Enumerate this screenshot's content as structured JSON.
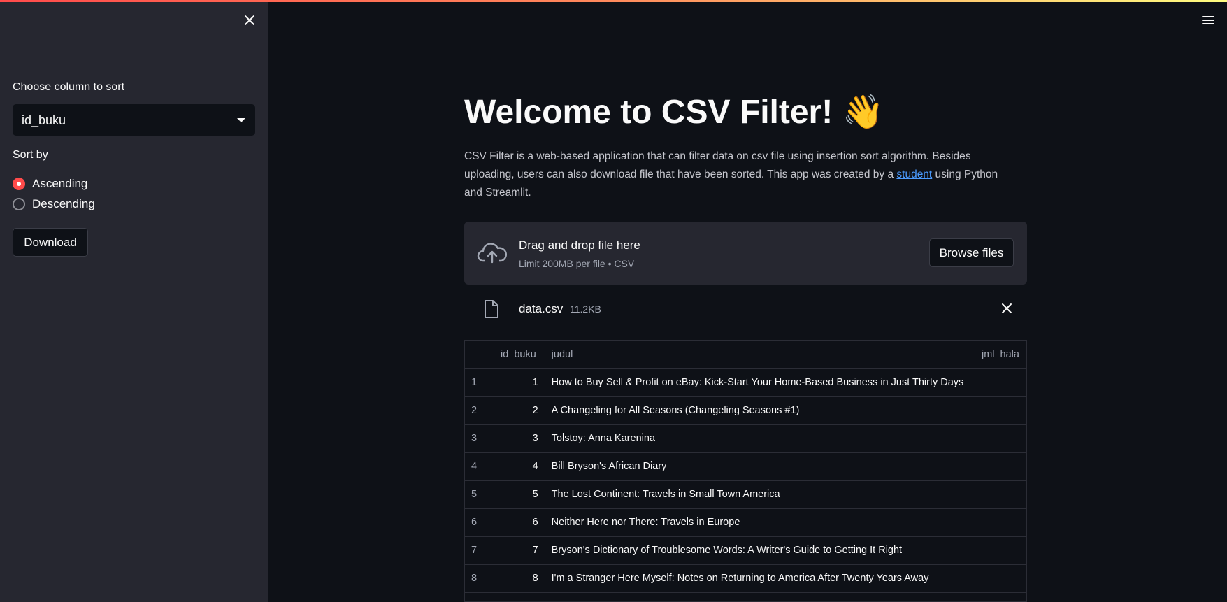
{
  "sidebar": {
    "sort_column_label": "Choose column to sort",
    "sort_column_value": "id_buku",
    "sort_by_label": "Sort by",
    "sort_options": [
      "Ascending",
      "Descending"
    ],
    "selected_sort": "Ascending",
    "download_label": "Download"
  },
  "main": {
    "title": "Welcome to CSV Filter! 👋",
    "intro_pre": "CSV Filter is a web-based application that can filter data on csv file using insertion sort algorithm. Besides uploading, users can also download file that have been sorted. This app was created by a ",
    "intro_link": "student",
    "intro_post": " using Python and Streamlit."
  },
  "uploader": {
    "title": "Drag and drop file here",
    "subtitle": "Limit 200MB per file • CSV",
    "browse_label": "Browse files"
  },
  "file": {
    "name": "data.csv",
    "size": "11.2KB"
  },
  "table": {
    "columns": [
      "id_buku",
      "judul",
      "jml_hala"
    ],
    "rows": [
      {
        "index": "1",
        "id_buku": "1",
        "judul": "How to Buy  Sell & Profit on eBay: Kick-Start Your Home-Based Business in Just Thirty Days"
      },
      {
        "index": "2",
        "id_buku": "2",
        "judul": "A Changeling for All Seasons (Changeling Seasons #1)"
      },
      {
        "index": "3",
        "id_buku": "3",
        "judul": "Tolstoy: Anna Karenina"
      },
      {
        "index": "4",
        "id_buku": "4",
        "judul": "Bill Bryson's African Diary"
      },
      {
        "index": "5",
        "id_buku": "5",
        "judul": "The Lost Continent: Travels in Small Town America"
      },
      {
        "index": "6",
        "id_buku": "6",
        "judul": "Neither Here nor There: Travels in Europe"
      },
      {
        "index": "7",
        "id_buku": "7",
        "judul": "Bryson's Dictionary of Troublesome Words: A Writer's Guide to Getting It Right"
      },
      {
        "index": "8",
        "id_buku": "8",
        "judul": "I'm a Stranger Here Myself: Notes on Returning to America After Twenty Years Away"
      }
    ]
  },
  "colors": {
    "accent": "#ff4b4b",
    "link": "#4b9bff",
    "sidebar_bg": "#262730",
    "main_bg": "#0e1117"
  }
}
